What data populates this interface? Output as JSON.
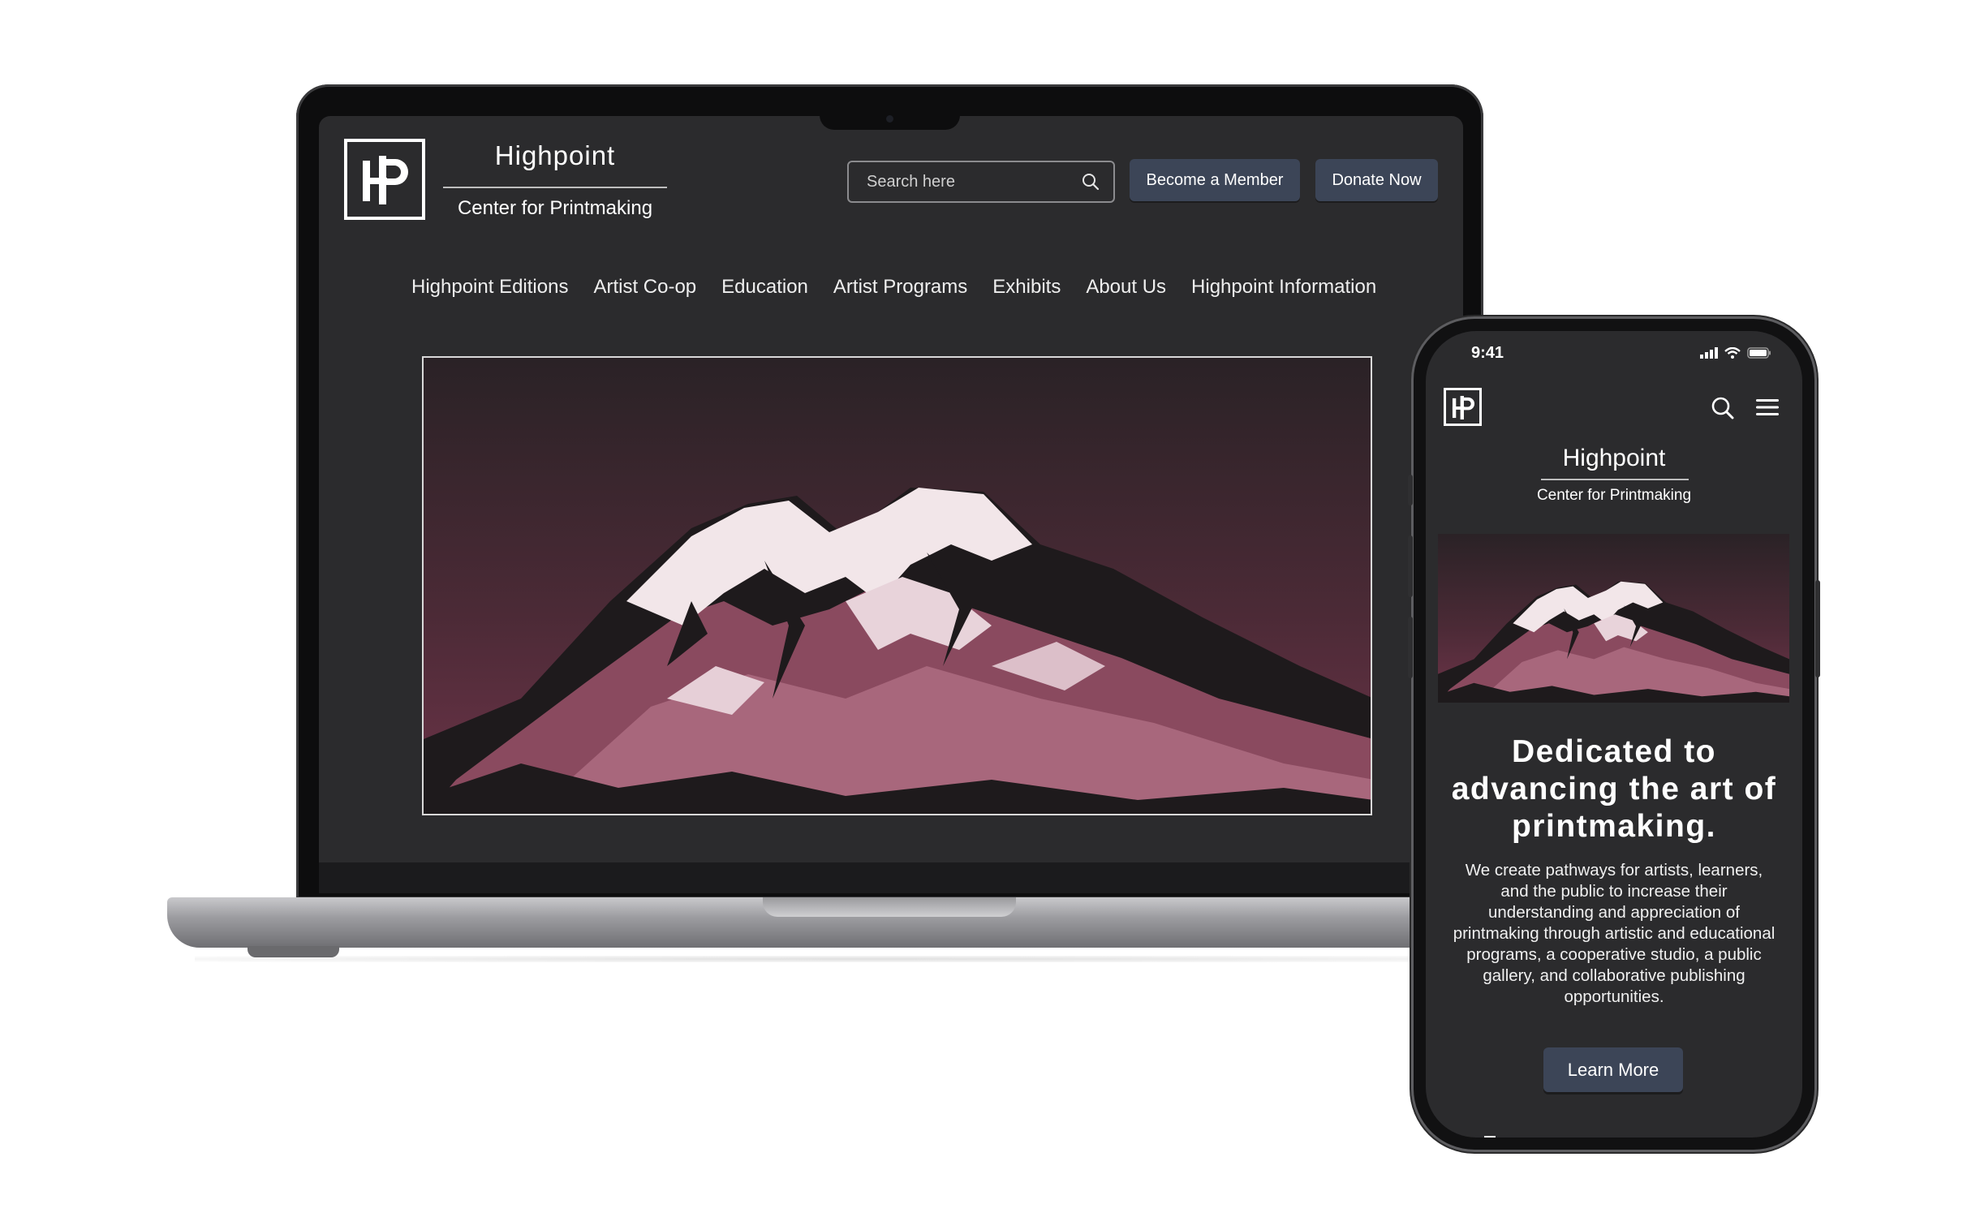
{
  "brand": {
    "name": "Highpoint",
    "subtitle": "Center for Printmaking"
  },
  "desktop": {
    "search": {
      "placeholder": "Search here"
    },
    "buttons": {
      "member_label": "Become a Member",
      "donate_label": "Donate Now"
    },
    "nav": [
      "Highpoint Editions",
      "Artist Co-op",
      "Education",
      "Artist Programs",
      "Exhibits",
      "About Us",
      "Highpoint Information"
    ],
    "hero_image": "mountain-print"
  },
  "mobile": {
    "status_time": "9:41",
    "heading": "Dedicated to advancing the art of printmaking.",
    "body": "We create pathways for artists, learners, and the public to increase their understanding and appreciation of printmaking through artistic and educational programs, a cooperative studio, a public gallery, and collaborative publishing opportunities.",
    "cta_label": "Learn More",
    "icons": [
      "search-icon",
      "menu-icon"
    ]
  },
  "colors": {
    "page_bg": "#2b2b2d",
    "button_bg": "#3c4557",
    "hero_tint": "#6b3346"
  }
}
